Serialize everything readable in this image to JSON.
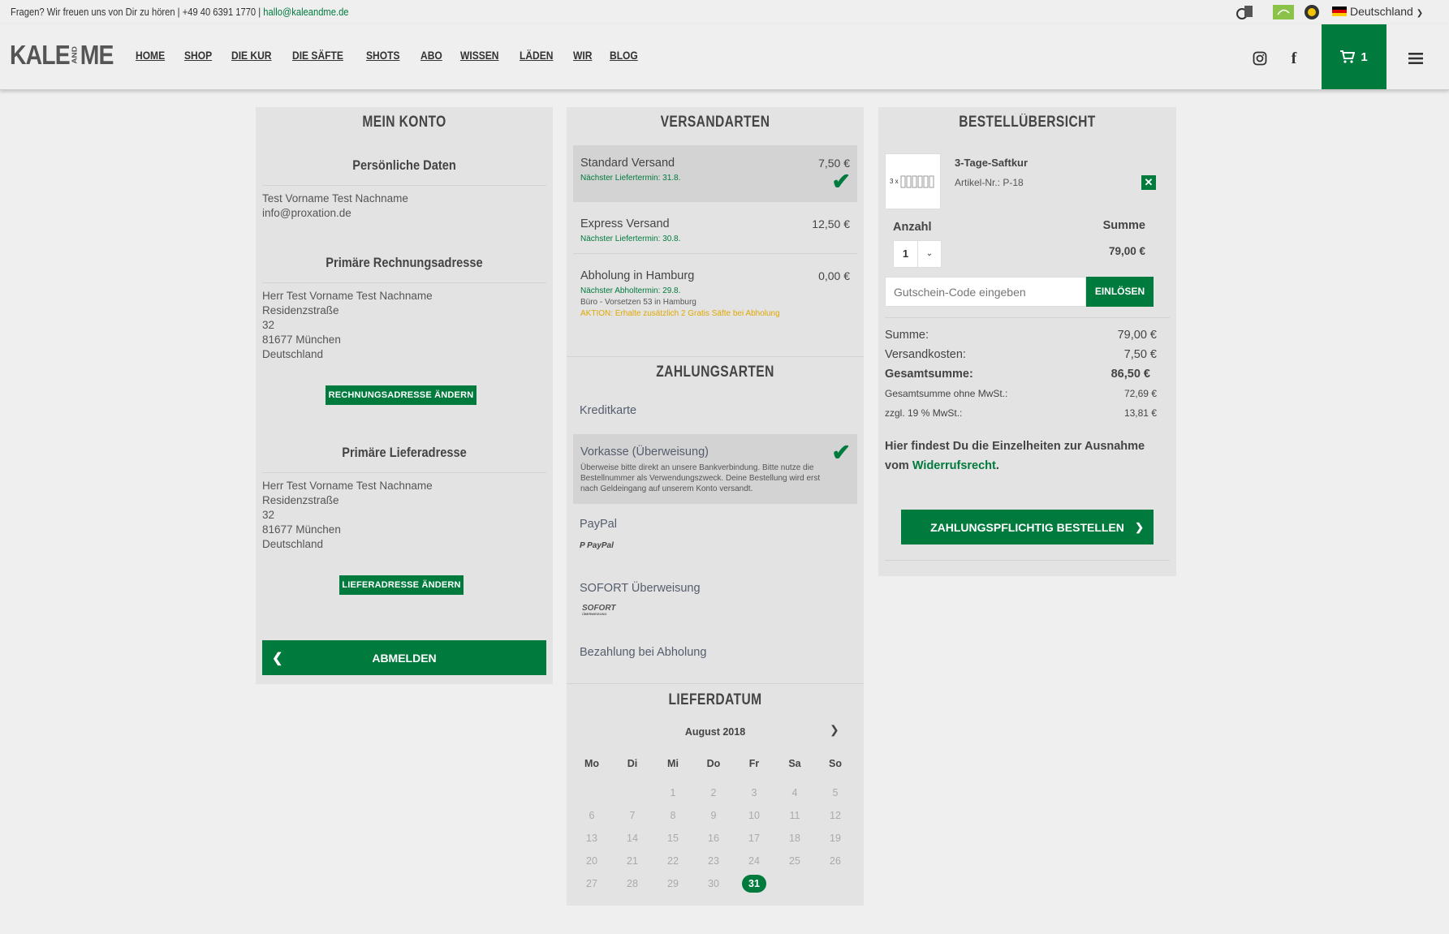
{
  "topbar": {
    "question": "Fragen? Wir freuen uns von Dir zu hören | +49 40 6391 1770 |",
    "email": "hallo@kaleandme.de",
    "country": "Deutschland"
  },
  "header": {
    "logo_left": "KALE",
    "logo_and": "AND",
    "logo_right": "ME",
    "nav": [
      "HOME",
      "SHOP",
      "DIE KUR",
      "DIE SÄFTE",
      "SHOTS",
      "ABO",
      "WISSEN",
      "LÄDEN",
      "WIR",
      "BLOG"
    ],
    "cart_count": "1"
  },
  "account": {
    "title": "MEIN KONTO",
    "personal_title": "Persönliche Daten",
    "personal": [
      "Test Vorname Test Nachname",
      "info@proxation.de"
    ],
    "billing_title": "Primäre Rechnungsadresse",
    "billing": [
      "Herr Test Vorname Test Nachname",
      "Residenzstraße",
      "32",
      "81677 München",
      "Deutschland"
    ],
    "billing_button": "RECHNUNGSADRESSE ÄNDERN",
    "shipping_title": "Primäre Lieferadresse",
    "shipping": [
      "Herr Test Vorname Test Nachname",
      "Residenzstraße",
      "32",
      "81677 München",
      "Deutschland"
    ],
    "shipping_button": "LIEFERADRESSE ÄNDERN",
    "logout": "ABMELDEN"
  },
  "shipping_methods": {
    "title": "VERSANDARTEN",
    "items": [
      {
        "name": "Standard Versand",
        "price": "7,50 €",
        "note": "Nächster Liefertermin: 31.8."
      },
      {
        "name": "Express Versand",
        "price": "12,50 €",
        "note": "Nächster Liefertermin: 30.8."
      },
      {
        "name": "Abholung in Hamburg",
        "price": "0,00 €",
        "note": "Nächster Abholtermin: 29.8.",
        "extra": "Büro - Vorsetzen 53 in Hamburg",
        "promo": "AKTION: Erhalte zusätzlich 2 Gratis Säfte bei Abholung"
      }
    ]
  },
  "payment": {
    "title": "ZAHLUNGSARTEN",
    "items": [
      {
        "name": "Kreditkarte"
      },
      {
        "name": "Vorkasse (Überweisung)",
        "desc": "Überweise bitte direkt an unsere Bankverbindung. Bitte nutze die Bestellnummer als Verwendungszweck. Deine Bestellung wird erst nach Geldeingang auf unserem Konto versandt."
      },
      {
        "name": "PayPal",
        "logo": "PayPal"
      },
      {
        "name": "SOFORT Überweisung",
        "logo": "SOFORT",
        "logo_sub": "ÜBERWEISUNG"
      },
      {
        "name": "Bezahlung bei Abholung"
      }
    ]
  },
  "delivery": {
    "title": "LIEFERDATUM",
    "month": "August 2018",
    "weekdays": [
      "Mo",
      "Di",
      "Mi",
      "Do",
      "Fr",
      "Sa",
      "So"
    ],
    "weeks": [
      [
        "",
        "",
        "1",
        "2",
        "3",
        "4",
        "5"
      ],
      [
        "6",
        "7",
        "8",
        "9",
        "10",
        "11",
        "12"
      ],
      [
        "13",
        "14",
        "15",
        "16",
        "17",
        "18",
        "19"
      ],
      [
        "20",
        "21",
        "22",
        "23",
        "24",
        "25",
        "26"
      ],
      [
        "27",
        "28",
        "29",
        "30",
        "31",
        "",
        ""
      ]
    ],
    "selected": "31"
  },
  "order": {
    "title": "BESTELLÜBERSICHT",
    "product_name": "3-Tage-Saftkur",
    "product_sku": "Artikel-Nr.: P-18",
    "product_thumb": "3 x",
    "qty_label": "Anzahl",
    "sum_label": "Summe",
    "qty": "1",
    "line_total": "79,00 €",
    "coupon_placeholder": "Gutschein-Code eingeben",
    "coupon_button": "EINLÖSEN",
    "totals": [
      {
        "label": "Summe:",
        "value": "79,00 €"
      },
      {
        "label": "Versandkosten:",
        "value": "7,50 €"
      },
      {
        "label": "Gesamtsumme:",
        "value": "86,50 €"
      },
      {
        "label": "Gesamtsumme ohne MwSt.:",
        "value": "72,69 €"
      },
      {
        "label": "zzgl. 19 % MwSt.:",
        "value": "13,81 €"
      }
    ],
    "withdrawal_text": "Hier findest Du die Einzelheiten zur Ausnahme vom",
    "withdrawal_link": "Widerrufsrecht",
    "withdrawal_end": ".",
    "order_button": "ZAHLUNGSPFLICHTIG BESTELLEN"
  },
  "colors": {
    "accent": "#007a3d",
    "promo": "#e0a800"
  }
}
